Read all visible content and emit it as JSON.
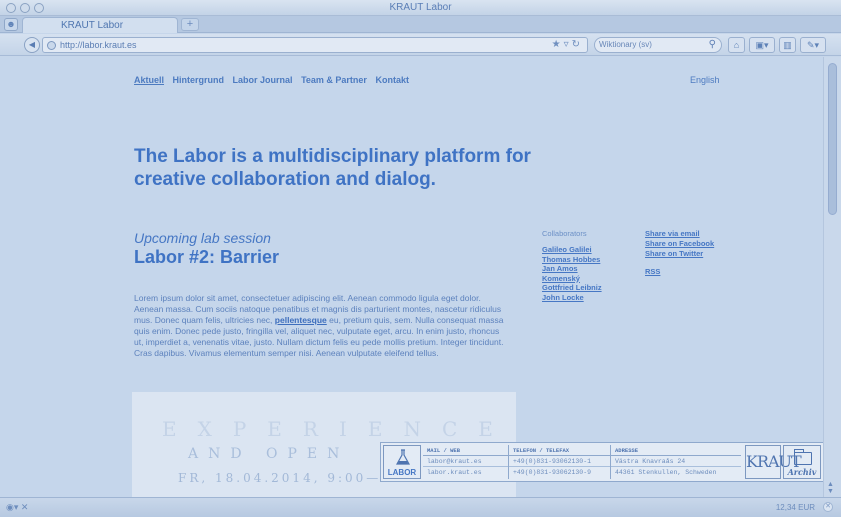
{
  "window": {
    "title": "KRAUT Labor"
  },
  "tabs": [
    {
      "label": "KRAUT Labor"
    }
  ],
  "toolbar": {
    "url": "http://labor.kraut.es",
    "search_engine": "Wiktionary (sv)",
    "new_tab": "+"
  },
  "nav": {
    "items": [
      "Aktuell",
      "Hintergrund",
      "Labor Journal",
      "Team & Partner",
      "Kontakt"
    ],
    "language": "English"
  },
  "headline": "The Labor is a multidisciplinary platform for creative collaboration and dialog.",
  "session": {
    "kicker": "Upcoming lab session",
    "title": "Labor #2: Barrier"
  },
  "body": {
    "before_link": "Lorem ipsum dolor sit amet, consectetuer adipiscing elit. Aenean commodo ligula eget dolor. Aenean massa. Cum sociis natoque penatibus et magnis dis parturient montes, nascetur ridiculus mus. Donec quam felis, ultricies nec,",
    "link": "pellentesque",
    "after_link": "eu, pretium quis, sem. Nulla consequat massa quis enim. Donec pede justo, fringilla vel, aliquet nec, vulputate eget, arcu. In enim justo, rhoncus ut, imperdiet a, venenatis vitae, justo. Nullam dictum felis eu pede mollis pretium. Integer tincidunt. Cras dapibus. Vivamus elementum semper nisi. Aenean vulputate eleifend tellus."
  },
  "collaborators": {
    "heading": "Collaborators",
    "names": [
      "Galileo Galilei",
      "Thomas Hobbes",
      "Jan Amos",
      "Komenský",
      "Gottfried Leibniz",
      "John Locke"
    ]
  },
  "share": {
    "links": [
      "Share via email",
      "Share on Facebook",
      "Share on Twitter"
    ],
    "rss": "RSS"
  },
  "poster": {
    "line1": "EXPERIENCE",
    "line2": "AND OPEN",
    "line3": "FR, 18.04.2014, 9:00—"
  },
  "contact": {
    "logo_label": "LABOR",
    "mail_heading": "MAIL / WEB",
    "mail": [
      "labor@kraut.es",
      "labor.kraut.es"
    ],
    "phone_heading": "TELEFON / TELEFAX",
    "phone": [
      "+49(0)831-93062130-1",
      "+49(0)831-93062130-9"
    ],
    "address_heading": "ADRESSE",
    "address": [
      "Västra Knavraås 24",
      "44361 Stenkullen, Schweden"
    ],
    "kraut_logo": "KRAUT",
    "archive_label": "Archiv"
  },
  "status": {
    "price": "12,34 EUR"
  },
  "colors": {
    "accent": "#3f73c4",
    "background": "#c5d6eb"
  }
}
